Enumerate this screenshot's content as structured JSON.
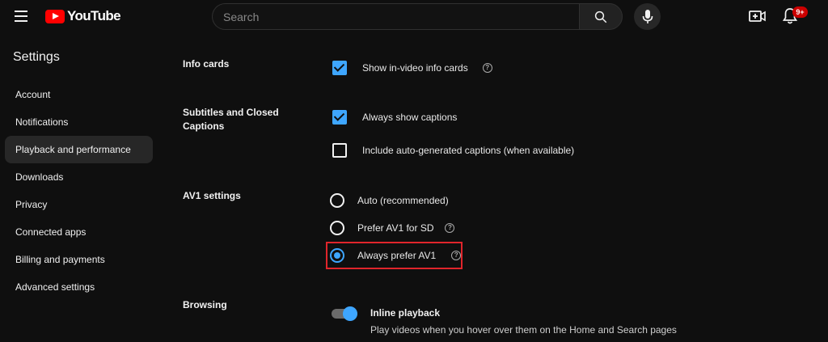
{
  "header": {
    "logo_text": "YouTube",
    "search_placeholder": "Search",
    "notification_count": "9+"
  },
  "sidebar": {
    "title": "Settings",
    "items": [
      {
        "label": "Account"
      },
      {
        "label": "Notifications"
      },
      {
        "label": "Playback and performance",
        "active": true
      },
      {
        "label": "Downloads"
      },
      {
        "label": "Privacy"
      },
      {
        "label": "Connected apps"
      },
      {
        "label": "Billing and payments"
      },
      {
        "label": "Advanced settings"
      }
    ]
  },
  "sections": {
    "info_cards": {
      "label": "Info cards",
      "options": [
        {
          "label": "Show in-video info cards",
          "checked": true
        }
      ]
    },
    "subtitles": {
      "label": "Subtitles and Closed Captions",
      "options": [
        {
          "label": "Always show captions",
          "checked": true
        },
        {
          "label": "Include auto-generated captions (when available)",
          "checked": false
        }
      ]
    },
    "av1": {
      "label": "AV1 settings",
      "options": [
        {
          "label": "Auto (recommended)",
          "selected": false
        },
        {
          "label": "Prefer AV1 for SD",
          "selected": false
        },
        {
          "label": "Always prefer AV1",
          "selected": true
        }
      ]
    },
    "browsing": {
      "label": "Browsing",
      "toggle_title": "Inline playback",
      "toggle_description": "Play videos when you hover over them on the Home and Search pages",
      "toggle_on": true
    }
  },
  "colors": {
    "background": "#0f0f0f",
    "accent": "#3ea6ff",
    "brand": "#ff0000",
    "highlight": "#e0252b"
  }
}
